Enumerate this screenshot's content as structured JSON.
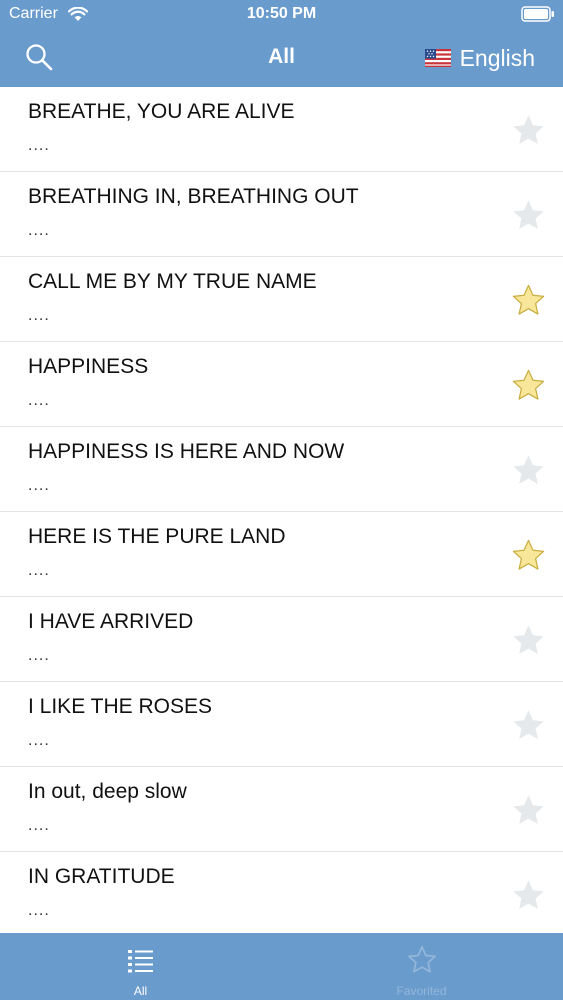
{
  "status_bar": {
    "carrier": "Carrier",
    "time": "10:50 PM"
  },
  "nav": {
    "title": "All",
    "language": "English",
    "flag_icon": "us-flag-icon"
  },
  "colors": {
    "header_bg": "#6a9bcd",
    "star_favorited": "#f8e79a",
    "star_unfavorited": "#e6e9ec"
  },
  "items": [
    {
      "title": "BREATHE, YOU ARE ALIVE",
      "subtitle": "....",
      "favorited": false
    },
    {
      "title": "BREATHING IN, BREATHING OUT",
      "subtitle": "....",
      "favorited": false
    },
    {
      "title": "CALL ME BY MY TRUE NAME",
      "subtitle": "....",
      "favorited": true
    },
    {
      "title": "HAPPINESS",
      "subtitle": "....",
      "favorited": true
    },
    {
      "title": "HAPPINESS IS HERE AND NOW",
      "subtitle": "....",
      "favorited": false
    },
    {
      "title": "HERE IS THE PURE LAND",
      "subtitle": "....",
      "favorited": true
    },
    {
      "title": "I HAVE ARRIVED",
      "subtitle": "....",
      "favorited": false
    },
    {
      "title": "I LIKE THE ROSES",
      "subtitle": "....",
      "favorited": false
    },
    {
      "title": "In out, deep slow",
      "subtitle": "....",
      "favorited": false
    },
    {
      "title": "IN GRATITUDE",
      "subtitle": "....",
      "favorited": false
    }
  ],
  "tabs": {
    "all_label": "All",
    "favorited_label": "Favorited"
  }
}
